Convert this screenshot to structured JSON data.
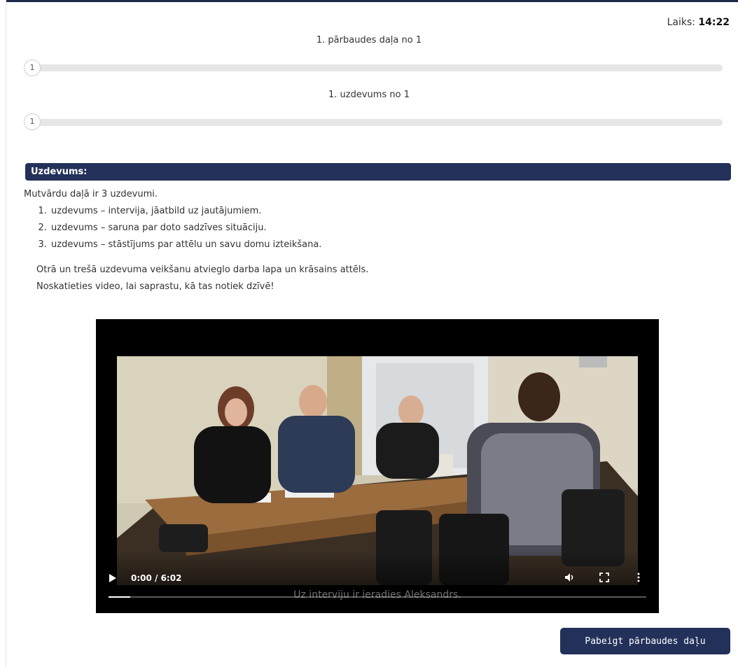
{
  "timer": {
    "label": "Laiks:",
    "value": "14:22"
  },
  "section_progress": {
    "title": "1. pārbaudes daļa no 1",
    "step": "1",
    "fraction": 0.0
  },
  "task_progress": {
    "title": "1. uzdevums no 1",
    "step": "1",
    "fraction": 0.0
  },
  "task": {
    "header": "Uzdevums:",
    "intro": "Mutvārdu daļā ir 3 uzdevumi.",
    "items": [
      "uzdevums – intervija, jāatbild uz jautājumiem.",
      "uzdevums – saruna par doto sadzīves situāciju.",
      "uzdevums – stāstījums par attēlu un savu domu izteikšana."
    ],
    "note_1": "Otrā un trešā uzdevuma veikšanu atvieglo darba lapa un krāsains attēls.",
    "note_2": "Noskatieties video, lai saprastu, kā tas notiek dzīvē!"
  },
  "video": {
    "time": "0:00 / 6:02",
    "caption": "Uz interviju ir ieradies Aleksandrs.",
    "progress": 0.04,
    "controls": [
      "play-icon",
      "volume-icon",
      "fullscreen-icon",
      "more-options-icon"
    ]
  },
  "finish_button": {
    "label": "Pabeigt pārbaudes daļu"
  },
  "colors": {
    "accent": "#23315a",
    "track": "#e6e6e6"
  }
}
